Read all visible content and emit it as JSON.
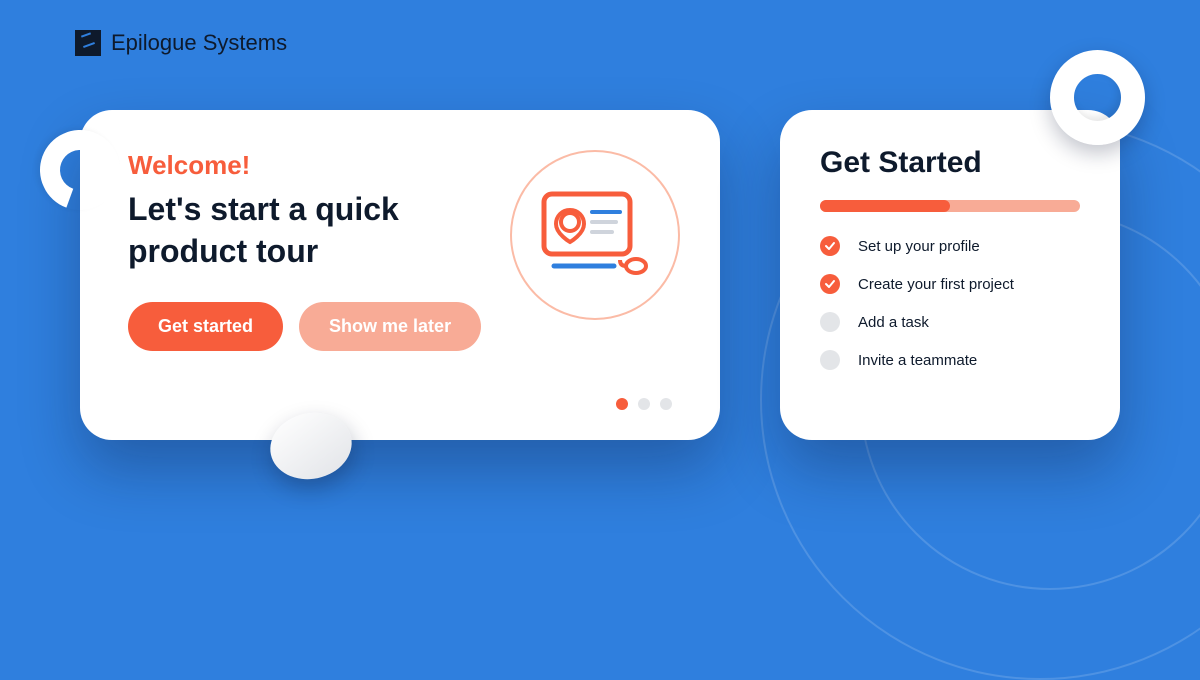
{
  "brand": {
    "name": "Epilogue Systems"
  },
  "tour": {
    "welcome": "Welcome!",
    "heading": "Let's start a quick product tour",
    "primary_label": "Get started",
    "secondary_label": "Show me later",
    "pager": {
      "total": 3,
      "active_index": 0
    }
  },
  "checklist": {
    "title": "Get Started",
    "progress_percent": 50,
    "items": [
      {
        "label": "Set up your profile",
        "done": true
      },
      {
        "label": "Create your first project",
        "done": true
      },
      {
        "label": "Add a task",
        "done": false
      },
      {
        "label": "Invite a teammate",
        "done": false
      }
    ]
  },
  "colors": {
    "accent": "#f75d3c",
    "accent_light": "#f8ab96",
    "bg": "#2f7fde",
    "text": "#0e1a2c"
  }
}
